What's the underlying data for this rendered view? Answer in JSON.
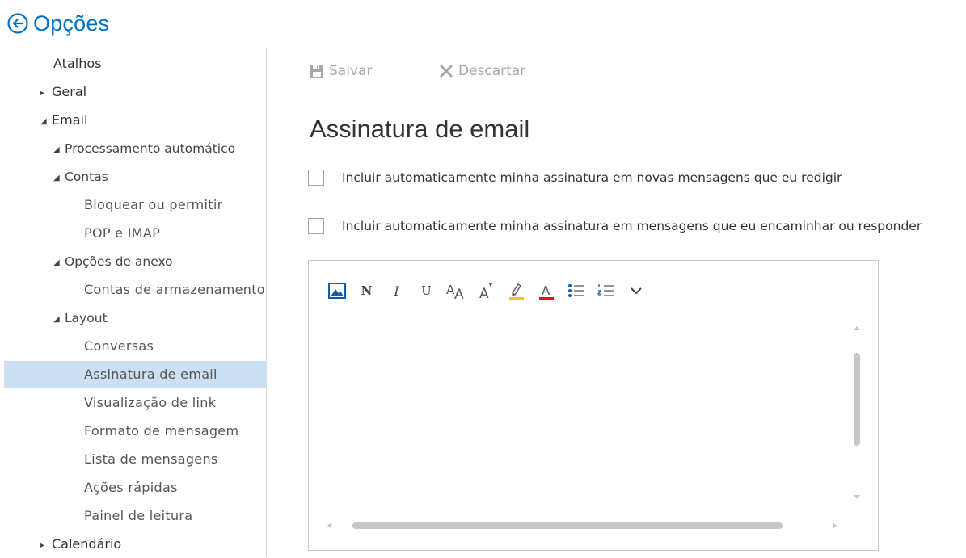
{
  "header": {
    "title": "Opções",
    "back_icon": "back-arrow-circle-icon",
    "accent": "#0072c6"
  },
  "sidebar": {
    "items": [
      {
        "label": "Atalhos",
        "level": 0,
        "expander": "none"
      },
      {
        "label": "Geral",
        "level": 0,
        "expander": "collapsed"
      },
      {
        "label": "Email",
        "level": 0,
        "expander": "expanded"
      },
      {
        "label": "Processamento automático",
        "level": 1,
        "expander": "expanded"
      },
      {
        "label": "Contas",
        "level": 1,
        "expander": "expanded"
      },
      {
        "label": "Bloquear ou permitir",
        "level": 2,
        "expander": "none"
      },
      {
        "label": "POP e IMAP",
        "level": 2,
        "expander": "none"
      },
      {
        "label": "Opções de anexo",
        "level": 1,
        "expander": "expanded"
      },
      {
        "label": "Contas de armazenamento",
        "level": 2,
        "expander": "none"
      },
      {
        "label": "Layout",
        "level": 1,
        "expander": "expanded"
      },
      {
        "label": "Conversas",
        "level": 2,
        "expander": "none"
      },
      {
        "label": "Assinatura de email",
        "level": 2,
        "expander": "none",
        "selected": true
      },
      {
        "label": "Visualização de link",
        "level": 2,
        "expander": "none"
      },
      {
        "label": "Formato de mensagem",
        "level": 2,
        "expander": "none"
      },
      {
        "label": "Lista de mensagens",
        "level": 2,
        "expander": "none"
      },
      {
        "label": "Ações rápidas",
        "level": 2,
        "expander": "none"
      },
      {
        "label": "Painel de leitura",
        "level": 2,
        "expander": "none"
      },
      {
        "label": "Calendário",
        "level": 0,
        "expander": "collapsed"
      }
    ],
    "selected_color": "#cde0f3"
  },
  "commands": {
    "save_label": "Salvar",
    "save_icon": "floppy-disk-icon",
    "discard_label": "Descartar",
    "discard_icon": "x-icon",
    "disabled_color": "#a8a8a8"
  },
  "page": {
    "title": "Assinatura de email"
  },
  "options": {
    "auto_new": {
      "label": "Incluir automaticamente minha assinatura em novas mensagens que eu redigir",
      "checked": false
    },
    "auto_forward": {
      "label": "Incluir automaticamente minha assinatura em mensagens que eu encaminhar ou responder",
      "checked": false
    }
  },
  "editor": {
    "toolbar": [
      {
        "name": "insert-picture",
        "icon": "picture-icon",
        "glyph": ""
      },
      {
        "name": "bold",
        "icon": "bold-icon",
        "glyph": "N"
      },
      {
        "name": "italic",
        "icon": "italic-icon",
        "glyph": "I"
      },
      {
        "name": "underline",
        "icon": "underline-icon",
        "glyph": "U"
      },
      {
        "name": "font-size",
        "icon": "font-size-icon",
        "glyph": "AA"
      },
      {
        "name": "grow-font",
        "icon": "grow-font-icon",
        "glyph": "A"
      },
      {
        "name": "highlight",
        "icon": "highlight-icon",
        "glyph": ""
      },
      {
        "name": "font-color",
        "icon": "font-color-icon",
        "glyph": "A"
      },
      {
        "name": "bullets",
        "icon": "bullet-list-icon",
        "glyph": ""
      },
      {
        "name": "numbering",
        "icon": "numbered-list-icon",
        "glyph": ""
      },
      {
        "name": "more",
        "icon": "chevron-down-icon",
        "glyph": ""
      }
    ],
    "highlight_color": "#f2c12e",
    "font_color": "#e81123",
    "picture_color": "#0f5ea8",
    "content": ""
  }
}
